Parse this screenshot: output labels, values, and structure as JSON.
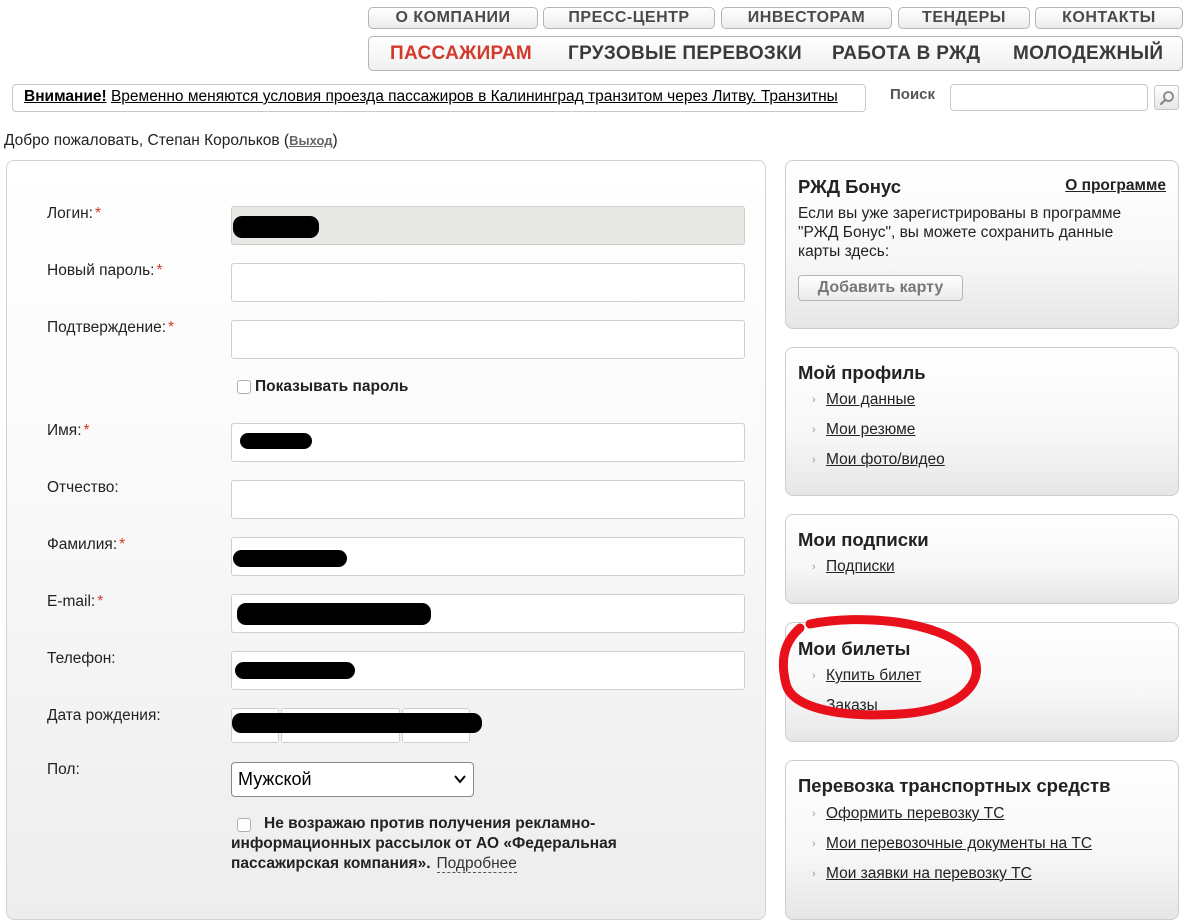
{
  "top_nav": [
    "О КОМПАНИИ",
    "ПРЕСС-ЦЕНТР",
    "ИНВЕСТОРАМ",
    "ТЕНДЕРЫ",
    "КОНТАКТЫ"
  ],
  "main_nav": [
    "ПАССАЖИРАМ",
    "ГРУЗОВЫЕ ПЕРЕВОЗКИ",
    "РАБОТА В РЖД",
    "МОЛОДЕЖНЫЙ"
  ],
  "ticker": {
    "label": "Внимание!",
    "message": "Временно меняются условия проезда пассажиров в Калининград транзитом через Литву. Транзитны"
  },
  "search": {
    "label": "Поиск",
    "placeholder": ""
  },
  "welcome": {
    "text": "Добро пожаловать, Степан Корольков (",
    "logout": "Выход",
    "close": ")"
  },
  "form": {
    "login_label": "Логин:",
    "new_password_label": "Новый пароль:",
    "confirm_label": "Подтверждение:",
    "show_password_label": "Показывать пароль",
    "first_name_label": "Имя:",
    "patronymic_label": "Отчество:",
    "last_name_label": "Фамилия:",
    "email_label": "E-mail:",
    "phone_label": "Телефон:",
    "birth_label": "Дата рождения:",
    "gender_label": "Пол:",
    "gender_value": "Мужской",
    "consent_text": "Не возражаю против получения рекламно-информационных рассылок от АО «Федеральная пассажирская компания».",
    "consent_more": "Подробнее",
    "required_mark": "*"
  },
  "sidebar": {
    "bonus": {
      "title": "РЖД Бонус",
      "about_link": "О программе",
      "text": "Если вы уже зарегистрированы в программе \"РЖД Бонус\", вы можете сохранить данные карты здесь:",
      "add_button": "Добавить карту"
    },
    "profile": {
      "title": "Мой профиль",
      "links": [
        "Мои данные",
        "Мои резюме",
        "Мои фото/видео"
      ]
    },
    "subscriptions": {
      "title": "Мои подписки",
      "links": [
        "Подписки"
      ]
    },
    "tickets": {
      "title": "Мои билеты",
      "links": [
        "Купить билет",
        "Заказы"
      ]
    },
    "transport": {
      "title": "Перевозка транспортных средств",
      "links": [
        "Оформить перевозку ТС",
        "Мои перевозочные документы на ТС",
        "Мои заявки на перевозку ТС"
      ]
    }
  },
  "colors": {
    "accent_red": "#d23a2c",
    "annotation_red": "#e8101a"
  }
}
